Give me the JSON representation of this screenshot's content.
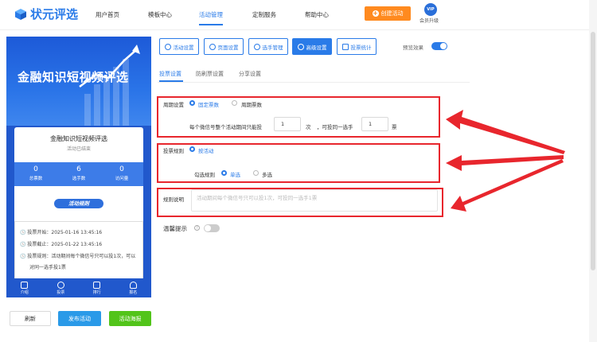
{
  "nav": {
    "logo_text": "状元评选",
    "items": [
      "用户首页",
      "模板中心",
      "活动管理",
      "定制服务",
      "帮助中心"
    ],
    "create_label": "创建活动",
    "vip_badge": "VIP",
    "vip_label": "会员升级"
  },
  "preview": {
    "banner_title": "金融知识短视频评选",
    "card_title": "金融知识短视频评选",
    "status": "活动已结束",
    "stats": [
      {
        "value": "0",
        "label": "总票数"
      },
      {
        "value": "6",
        "label": "选手数"
      },
      {
        "value": "0",
        "label": "访问量"
      }
    ],
    "rule_pill": "活动规则",
    "info": [
      "投票开始：2025-01-16 13:45:16",
      "投票截止：2025-01-22 13:45:16",
      "投票规则：活动期间每个微信号只可以投1次，可以",
      "对同一选手投1票"
    ],
    "tabs": [
      "介绍",
      "投票",
      "排行",
      "报名"
    ]
  },
  "bottom_buttons": {
    "refresh": "刷新",
    "publish": "发布活动",
    "poster": "活动海报"
  },
  "toolbar": {
    "buttons": [
      "活动设置",
      "页面设置",
      "选手管理",
      "高级设置",
      "投票统计"
    ],
    "preview_label": "预览效果"
  },
  "subtabs": [
    "投票设置",
    "防刷票设置",
    "分享设置"
  ],
  "form": {
    "cycle_label": "周期设置",
    "cycle_options": [
      "固定票数",
      "周期票数"
    ],
    "per_wechat_prefix": "每个微信号整个活动期间只能投",
    "per_wechat_value": "1",
    "per_wechat_unit": "次",
    "same_player_prefix": "，可投同一选手",
    "same_player_value": "1",
    "same_player_unit": "票",
    "rule_label": "投票规则",
    "rule_option": "按活动",
    "check_rule_label": "勾选规则",
    "check_options": [
      "单选",
      "多选"
    ],
    "desc_label": "规则说明",
    "desc_placeholder": "活动期间每个微信号只可以投1次，可投同一选手1票",
    "tip_label": "温馨提示",
    "tip_help": "?"
  },
  "colors": {
    "accent": "#2a7be8",
    "orange": "#ff8a1f",
    "green": "#52c41a",
    "annotation_red": "#e8262d"
  }
}
